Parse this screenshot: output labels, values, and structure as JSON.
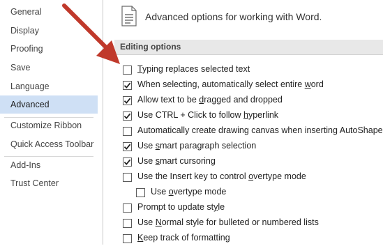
{
  "sidebar": {
    "items": [
      {
        "label": "General"
      },
      {
        "label": "Display"
      },
      {
        "label": "Proofing"
      },
      {
        "label": "Save"
      },
      {
        "label": "Language"
      },
      {
        "label": "Advanced"
      },
      {
        "label": "Customize Ribbon"
      },
      {
        "label": "Quick Access Toolbar"
      },
      {
        "label": "Add-Ins"
      },
      {
        "label": "Trust Center"
      }
    ],
    "active": "Advanced"
  },
  "header": {
    "title": "Advanced options for working with Word."
  },
  "section": {
    "title": "Editing options"
  },
  "options": [
    {
      "pre": "",
      "ul": "T",
      "post": "yping replaces selected text",
      "checked": false
    },
    {
      "pre": "When selecting, automatically select entire ",
      "ul": "w",
      "post": "ord",
      "checked": true
    },
    {
      "pre": "Allow text to be ",
      "ul": "d",
      "post": "ragged and dropped",
      "checked": true
    },
    {
      "pre": "Use CTRL + Click to follow ",
      "ul": "h",
      "post": "yperlink",
      "checked": true
    },
    {
      "pre": "Automatically create drawing canvas when inserting AutoShapes",
      "ul": "",
      "post": "",
      "checked": false
    },
    {
      "pre": "Use ",
      "ul": "s",
      "post": "mart paragraph selection",
      "checked": true
    },
    {
      "pre": "Use ",
      "ul": "s",
      "post": "mart cursoring",
      "checked": true
    },
    {
      "pre": "Use the Insert key to control ",
      "ul": "o",
      "post": "vertype mode",
      "checked": false
    },
    {
      "pre": "Use ",
      "ul": "o",
      "post": "vertype mode",
      "checked": false
    },
    {
      "pre": "Prompt to update st",
      "ul": "y",
      "post": "le",
      "checked": false
    },
    {
      "pre": "Use ",
      "ul": "N",
      "post": "ormal style for bulleted or numbered lists",
      "checked": false
    },
    {
      "pre": "",
      "ul": "K",
      "post": "eep track of formatting",
      "checked": false
    }
  ],
  "colors": {
    "arrow": "#c0392b",
    "active_bg": "#cfe0f5",
    "section_bg": "#e8e8e8"
  },
  "icons": {
    "header": "document-options-icon",
    "annotation": "red-arrow-icon",
    "check": "checkmark-icon"
  }
}
